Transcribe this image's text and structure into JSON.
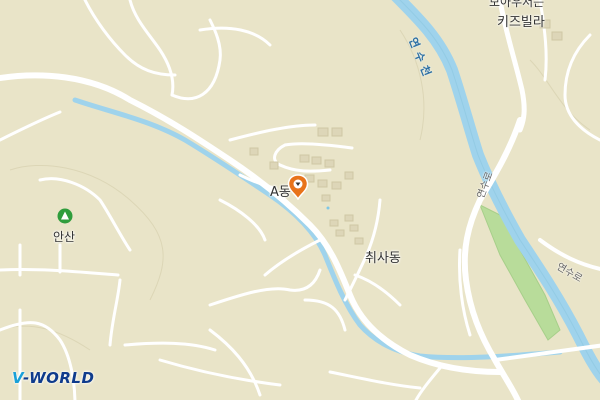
{
  "map": {
    "labels": {
      "river_yeonsucheon": "연수천",
      "kids_villa": "키즈빌라",
      "kids_villa_prefix": "모아우저는",
      "place_a": "A동",
      "chwisadong": "취사동",
      "yeonsuro_1": "연수로",
      "yeonsuro_2": "연수로",
      "ansan": "안산"
    },
    "logo": {
      "mark": "V",
      "text": "-WORLD"
    },
    "colors": {
      "land": "#e9e4c8",
      "road": "#ffffff",
      "water": "#9fd3ec",
      "park": "#b8dc9a",
      "pin": "#e8731a"
    },
    "icons": {
      "pin": "map-pin-icon",
      "mountain": "mountain-icon"
    }
  }
}
